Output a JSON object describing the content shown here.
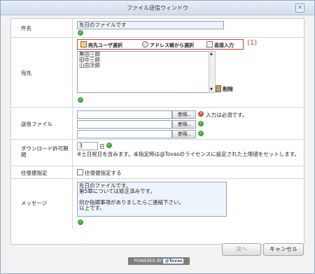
{
  "window": {
    "title": "ファイル送信ウィンドウ",
    "close_glyph": "×"
  },
  "subject": {
    "label": "件名",
    "value": "先日のファイルです"
  },
  "recipients": {
    "label": "宛先",
    "buttons": {
      "user_select": "宛先ユーザ選択",
      "address_book": "アドレス帳から選択",
      "direct_input": "直接入力"
    },
    "annotation": "(1)",
    "list": [
      "黒田三郎",
      "田中三郎",
      "山田次郎"
    ],
    "delete_label": "削除"
  },
  "send_files": {
    "label": "送信ファイル",
    "browse_label": "参照..",
    "required_message": "入力は必須です。"
  },
  "download_limit": {
    "label": "ダウンロード許可期間",
    "value": "3",
    "unit": "日",
    "note": "※土日祝日を含みます。未指定時は@Tovasのライセンスに設定された上限値をセットします。"
  },
  "return_mail": {
    "label": "往復便指定",
    "checkbox_label": "往復便指定する",
    "checked": false
  },
  "message": {
    "label": "メッセージ",
    "lines": [
      "先日のファイルです。",
      "第5章については修正済みです。",
      "",
      "何か指摘事項がありましたらご連絡下さい。",
      "以上です。"
    ]
  },
  "footer": {
    "next_label": "次へ",
    "cancel_label": "キャンセル",
    "powered_by": "POWERED BY",
    "brand": "@Tovas"
  },
  "colors": {
    "accent": "#d93a3a",
    "ok": "#42a53d",
    "error": "#d64a3a"
  }
}
